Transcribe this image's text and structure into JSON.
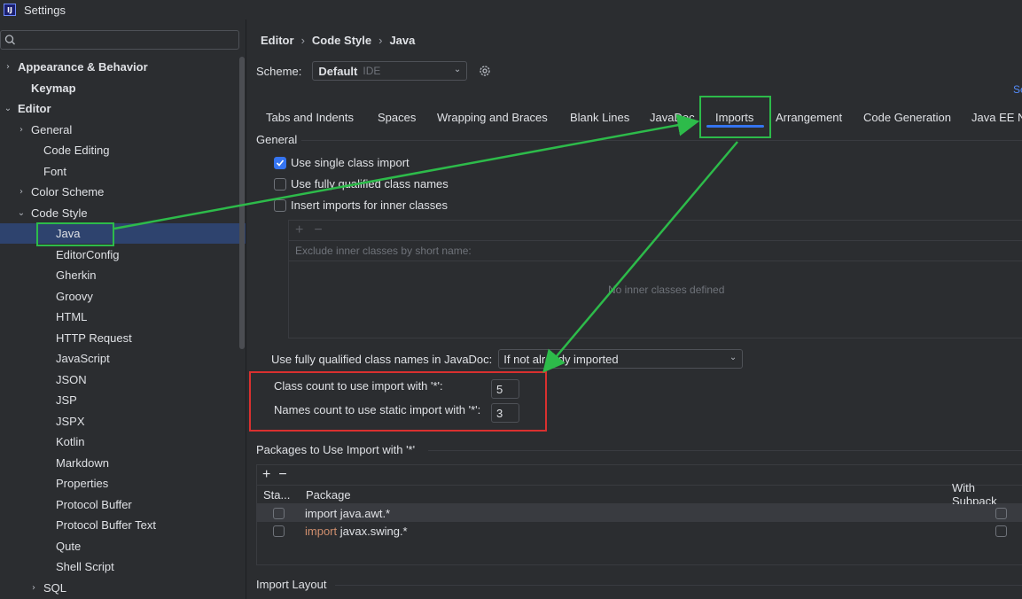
{
  "window": {
    "title": "Settings"
  },
  "sidebar": {
    "search_placeholder": "",
    "items": [
      {
        "label": "Appearance & Behavior",
        "chevron": "›",
        "bold": true
      },
      {
        "label": "Keymap",
        "chevron": "",
        "bold": true
      },
      {
        "label": "Editor",
        "chevron": "⌄",
        "bold": true
      },
      {
        "label": "General",
        "chevron": "›",
        "bold": false
      },
      {
        "label": "Code Editing",
        "chevron": "",
        "bold": false
      },
      {
        "label": "Font",
        "chevron": "",
        "bold": false
      },
      {
        "label": "Color Scheme",
        "chevron": "›",
        "bold": false
      },
      {
        "label": "Code Style",
        "chevron": "⌄",
        "bold": false
      },
      {
        "label": "Java",
        "chevron": "",
        "bold": false,
        "selected": true
      },
      {
        "label": "EditorConfig",
        "chevron": "",
        "bold": false
      },
      {
        "label": "Gherkin",
        "chevron": "",
        "bold": false
      },
      {
        "label": "Groovy",
        "chevron": "",
        "bold": false
      },
      {
        "label": "HTML",
        "chevron": "",
        "bold": false
      },
      {
        "label": "HTTP Request",
        "chevron": "",
        "bold": false
      },
      {
        "label": "JavaScript",
        "chevron": "",
        "bold": false
      },
      {
        "label": "JSON",
        "chevron": "",
        "bold": false
      },
      {
        "label": "JSP",
        "chevron": "",
        "bold": false
      },
      {
        "label": "JSPX",
        "chevron": "",
        "bold": false
      },
      {
        "label": "Kotlin",
        "chevron": "",
        "bold": false
      },
      {
        "label": "Markdown",
        "chevron": "",
        "bold": false
      },
      {
        "label": "Properties",
        "chevron": "",
        "bold": false
      },
      {
        "label": "Protocol Buffer",
        "chevron": "",
        "bold": false
      },
      {
        "label": "Protocol Buffer Text",
        "chevron": "",
        "bold": false
      },
      {
        "label": "Qute",
        "chevron": "",
        "bold": false
      },
      {
        "label": "Shell Script",
        "chevron": "",
        "bold": false
      },
      {
        "label": "SQL",
        "chevron": "›",
        "bold": false
      }
    ]
  },
  "main": {
    "breadcrumb": [
      "Editor",
      "Code Style",
      "Java"
    ],
    "breadcrumb_sep": "›",
    "scheme": {
      "label": "Scheme:",
      "value": "Default",
      "tag": "IDE"
    },
    "set_from_link": "Se",
    "tabs": [
      "Tabs and Indents",
      "Spaces",
      "Wrapping and Braces",
      "Blank Lines",
      "JavaDoc",
      "Imports",
      "Arrangement",
      "Code Generation",
      "Java EE N"
    ],
    "active_tab": "Imports",
    "general": {
      "title": "General",
      "use_single_class_import": "Use single class import",
      "use_fully_qualified": "Use fully qualified class names",
      "insert_imports_inner": "Insert imports for inner classes",
      "exclude_add": "+",
      "exclude_remove": "−",
      "exclude_header": "Exclude inner classes by short name:",
      "exclude_empty": "No inner classes defined"
    },
    "javadoc": {
      "label": "Use fully qualified class names in JavaDoc:",
      "value": "If not already imported"
    },
    "counts": {
      "class_count_label": "Class count to use import with '*':",
      "class_count_value": "5",
      "names_count_label": "Names count to use static import with '*':",
      "names_count_value": "3"
    },
    "packages": {
      "title": "Packages to Use Import with '*'",
      "add": "+",
      "remove": "−",
      "col_static": "Sta...",
      "col_package": "Package",
      "col_subpackages": "With Subpack",
      "rows": [
        {
          "keyword": "import",
          "pkg": "java.awt.*",
          "keyword_colored": false
        },
        {
          "keyword": "import",
          "pkg": "javax.swing.*",
          "keyword_colored": true
        }
      ]
    },
    "import_layout_title": "Import Layout"
  },
  "colors": {
    "accent": "#3574f0",
    "annotation_green": "#2dbb4a",
    "annotation_red": "#d9302f",
    "keyword": "#cf8e6d"
  }
}
